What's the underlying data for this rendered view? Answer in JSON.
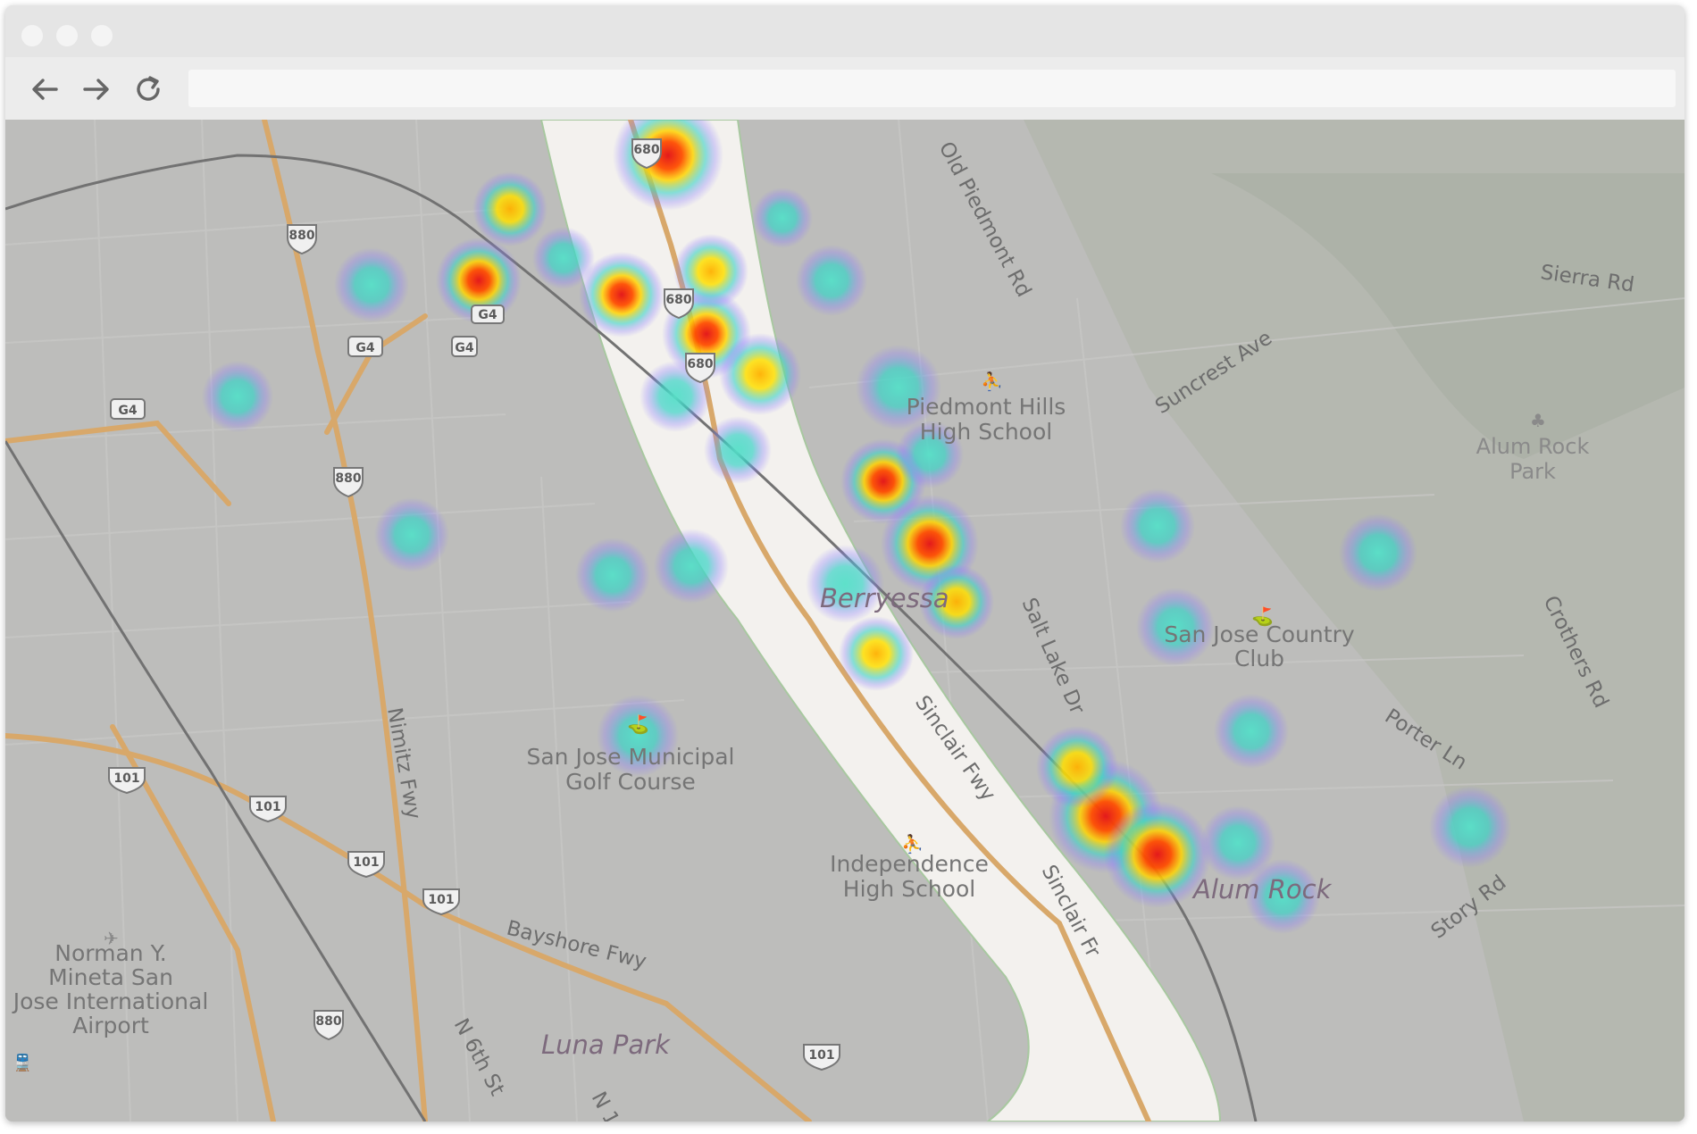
{
  "browser": {
    "url": "",
    "controls": {
      "back": "arrow-left-icon",
      "forward": "arrow-right-icon",
      "reload": "reload-icon"
    }
  },
  "map": {
    "colors": {
      "base": "#bdbdbb",
      "corridor": "#f3f1ee",
      "highway": "#d8a86a",
      "heat_hot": "#e31a1c",
      "heat_warm": "#ffd400",
      "heat_cool": "#3ad2c6",
      "heat_edge": "#8a7bff"
    },
    "labels": {
      "old_piedmont_rd": "Old Piedmont Rd",
      "sierra_rd": "Sierra Rd",
      "suncrest_ave": "Suncrest Ave",
      "piedmont_hills_line1": "Piedmont Hills",
      "piedmont_hills_line2": "High School",
      "alum_rock_park_line1": "Alum Rock",
      "alum_rock_park_line2": "Park",
      "berryessa": "Berryessa",
      "salt_lake_dr": "Salt Lake Dr",
      "sj_country_club_line1": "San Jose Country",
      "sj_country_club_line2": "Club",
      "crothers_rd": "Crothers Rd",
      "porter_ln": "Porter Ln",
      "sinclair_fwy_1": "Sinclair Fwy",
      "sinclair_fwy_2": "Sinclair Fr",
      "sj_golf_line1": "San Jose Municipal",
      "sj_golf_line2": "Golf Course",
      "nimitz_fwy": "Nimitz Fwy",
      "independence_line1": "Independence",
      "independence_line2": "High School",
      "alum_rock": "Alum Rock",
      "story_rd": "Story Rd",
      "bayshore_fwy": "Bayshore Fwy",
      "airport_line1": "Norman Y.",
      "airport_line2": "Mineta San",
      "airport_line3": "Jose International",
      "airport_line4": "Airport",
      "n_6th_st": "N 6th St",
      "luna_park": "Luna Park",
      "n1": "N 1"
    },
    "shields": {
      "i680_a": "680",
      "i680_b": "680",
      "i680_c": "680",
      "i880_a": "880",
      "i880_b": "880",
      "i880_c": "880",
      "g4_a": "G4",
      "g4_b": "G4",
      "g4_c": "G4",
      "g4_d": "G4",
      "us101_a": "101",
      "us101_b": "101",
      "us101_c": "101",
      "us101_d": "101",
      "us101_e": "101"
    }
  }
}
